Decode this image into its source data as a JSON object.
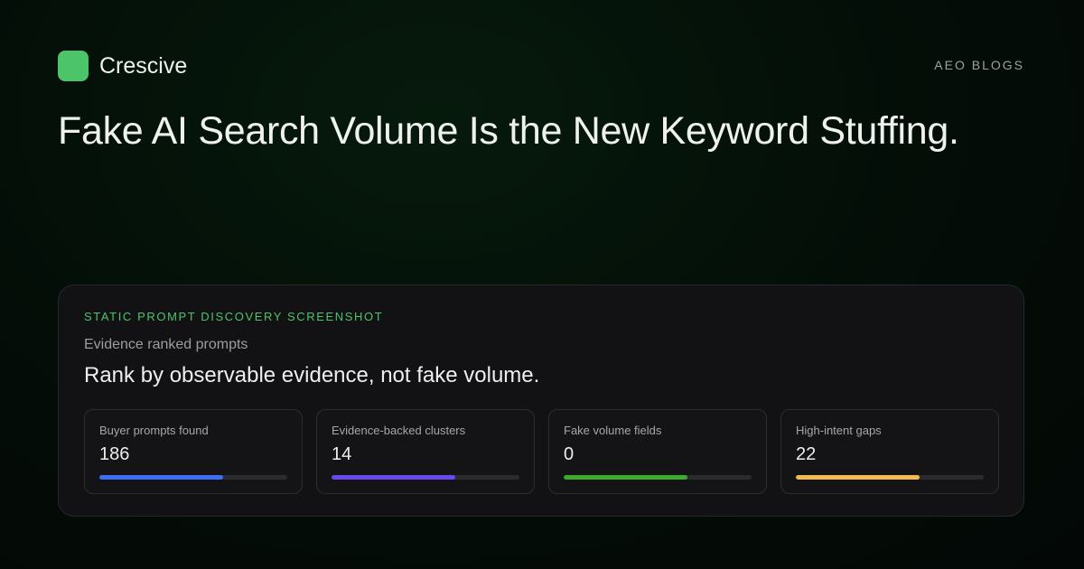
{
  "brand": {
    "name": "Crescive",
    "logo_color": "#4cc46a"
  },
  "section_label": "AEO BLOGS",
  "headline": "Fake AI Search Volume Is the New Keyword Stuffing.",
  "panel": {
    "tag": "STATIC  PROMPT DISCOVERY SCREENSHOT",
    "subtitle": "Evidence ranked prompts",
    "title": "Rank by observable evidence, not fake volume.",
    "metrics": [
      {
        "label": "Buyer prompts found",
        "value": "186",
        "progress": 0.66,
        "color": "#3d6ef5"
      },
      {
        "label": "Evidence-backed clusters",
        "value": "14",
        "progress": 0.66,
        "color": "#6a48f0"
      },
      {
        "label": "Fake volume fields",
        "value": "0",
        "progress": 0.66,
        "color": "#3dab2c"
      },
      {
        "label": "High-intent gaps",
        "value": "22",
        "progress": 0.66,
        "color": "#f2b94e"
      }
    ]
  }
}
